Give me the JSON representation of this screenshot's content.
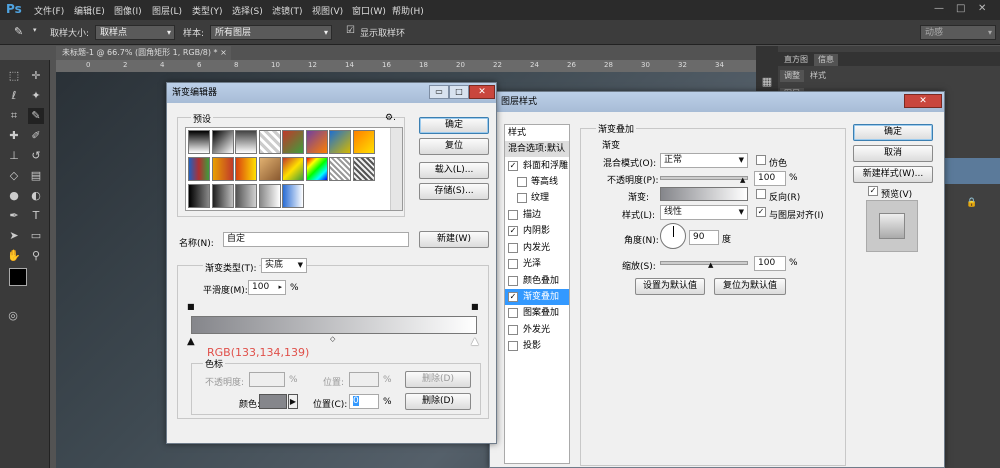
{
  "app": {
    "logo": "Ps"
  },
  "menu": [
    "文件(F)",
    "编辑(E)",
    "图像(I)",
    "图层(L)",
    "类型(Y)",
    "选择(S)",
    "滤镜(T)",
    "视图(V)",
    "窗口(W)",
    "帮助(H)"
  ],
  "window_controls": {
    "minimize": "—",
    "restore": "□",
    "close": "✕"
  },
  "options": {
    "sample_size_label": "取样大小:",
    "sample_size_value": "取样点",
    "sample_label": "样本:",
    "sample_value": "所有图层",
    "show_ring_label": "显示取样环",
    "workspace_value": "动感"
  },
  "document": {
    "tab": "未标题-1 @ 66.7% (圆角矩形 1, RGB/8) *",
    "close": "×"
  },
  "ruler": [
    "0",
    "2",
    "4",
    "6",
    "8",
    "10",
    "12",
    "14",
    "16",
    "18",
    "20",
    "22",
    "24",
    "26",
    "28",
    "30",
    "32",
    "34"
  ],
  "right_panel": {
    "tabs_top": [
      "直方图",
      "信息"
    ],
    "tabs_mid": [
      "调整",
      "样式"
    ],
    "tab3": "图层",
    "lock": "🔒"
  },
  "gradient_editor": {
    "title": "渐变编辑器",
    "presets_label": "预设",
    "gear": "⚙.",
    "buttons": {
      "ok": "确定",
      "reset": "复位",
      "load": "载入(L)...",
      "save": "存储(S)...",
      "new": "新建(W)"
    },
    "name_label": "名称(N):",
    "name_value": "自定",
    "type_label": "渐变类型(T):",
    "type_value": "实底",
    "smooth_label": "平滑度(M):",
    "smooth_value": "100",
    "smooth_unit": "%",
    "rgb_annotation": "RGB(133,134,139)",
    "stops_legend": "色标",
    "opacity_label": "不透明度:",
    "opacity_unit": "%",
    "location_label": "位置:",
    "location_unit": "%",
    "delete1": "删除(D)",
    "color_label": "颜色:",
    "position_label": "位置(C):",
    "position_value": "0",
    "position_unit": "%",
    "delete2": "删除(D)",
    "color_value": "#85868b",
    "presets": [
      "#000000",
      "#888888",
      "#444444",
      "#bcbcbc",
      "#c0392b",
      "#e8a000",
      "#1e6fd0",
      "#d4b800",
      "#ff7f00",
      "#2060c0",
      "#b03030",
      "#7040a0",
      "#3d9e3d",
      "#e0b070",
      "#5060a0",
      "#3080e0",
      "#70d0f0",
      "#d94010",
      "#999999",
      "#cfcfcf",
      "#555555",
      "#8a8a8a",
      "#202020",
      "#bfbfbf",
      "#2a6dd4",
      "#c8c8c8"
    ]
  },
  "layer_style": {
    "title": "图层样式",
    "styles_header": "样式",
    "blend_default": "混合选项:默认",
    "items": [
      {
        "label": "斜面和浮雕",
        "checked": true
      },
      {
        "label": "等高线",
        "checked": false
      },
      {
        "label": "纹理",
        "checked": false
      },
      {
        "label": "描边",
        "checked": false
      },
      {
        "label": "内阴影",
        "checked": true
      },
      {
        "label": "内发光",
        "checked": false
      },
      {
        "label": "光泽",
        "checked": false
      },
      {
        "label": "颜色叠加",
        "checked": false
      },
      {
        "label": "渐变叠加",
        "checked": true
      },
      {
        "label": "图案叠加",
        "checked": false
      },
      {
        "label": "外发光",
        "checked": false
      },
      {
        "label": "投影",
        "checked": false
      }
    ],
    "section_title": "渐变叠加",
    "subsection": "渐变",
    "blend_mode_label": "混合模式(O):",
    "blend_mode_value": "正常",
    "dither_label": "仿色",
    "opacity_label": "不透明度(P):",
    "opacity_value": "100",
    "opacity_unit": "%",
    "gradient_label": "渐变:",
    "reverse_label": "反向(R)",
    "style_label": "样式(L):",
    "style_value": "线性",
    "align_label": "与图层对齐(I)",
    "angle_label": "角度(N):",
    "angle_value": "90",
    "angle_unit": "度",
    "scale_label": "缩放(S):",
    "scale_value": "100",
    "scale_unit": "%",
    "make_default": "设置为默认值",
    "reset_default": "复位为默认值",
    "buttons": {
      "ok": "确定",
      "cancel": "取消",
      "new_style": "新建样式(W)...",
      "preview": "预览(V)"
    }
  }
}
